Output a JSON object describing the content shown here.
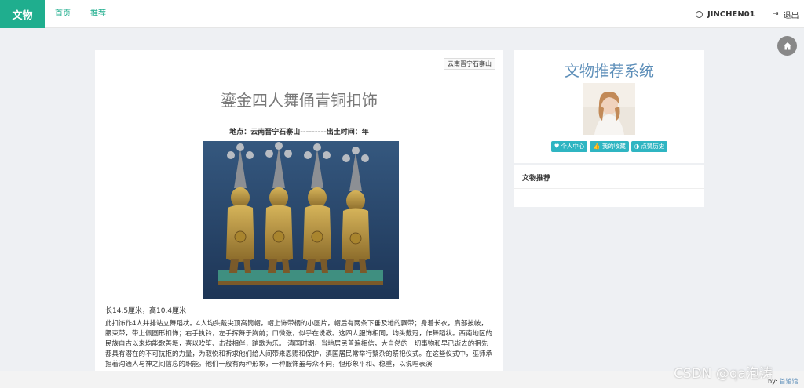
{
  "header": {
    "brand": "文物",
    "nav": {
      "home": "首页",
      "recommend": "推荐"
    },
    "username": "JINCHEN01",
    "logout": "退出"
  },
  "article": {
    "location_badge": "云南晋宁石寨山",
    "title": "鎏金四人舞俑青铜扣饰",
    "meta": "地点：云南晋宁石寨山---------出土时间：年",
    "dimensions": "长14.5厘米，高10.4厘米",
    "description": "此扣饰作4人并排站立舞蹈状。4人均头戴尖顶高筒帽，帽上饰带柄的小圆片，帽后有两条下垂及地的飘带；身着长衣，肩部披帔，腰束带，带上佩圆形扣饰；右手执铃，左手挥舞于胸前；口微张，似乎在说教。这四人服饰相同，均头戴冠，作舞蹈状。西南地区的民族自古以来均能歌善舞，喜以吹笙、击鼓相伴，踏歌为乐。 滇国时期，当地居民普遍相信，大自然的一切事物和早已逝去的祖先都具有潜在的不可抗拒的力量，为取悦和祈求他们给人间带来恩赐和保护，滇国居民常举行繁杂的祭祀仪式。在这些仪式中，巫师承担着沟通人与神之间信息的职能。他们一般有两种形象，一种服饰虽与众不同，但形象平和、稳重，以说唱表演"
  },
  "sidebar": {
    "title": "文物推荐系统",
    "buttons": {
      "profile": "个人中心",
      "favorites": "我的收藏",
      "history": "点赞历史"
    },
    "recommend_title": "文物推荐"
  },
  "footer": {
    "by": "by:",
    "author": "首馆馆"
  },
  "watermark": "CSDN @qa泡涛",
  "colors": {
    "brand": "#1fae8e",
    "accent_blue": "#5b8db8",
    "pill": "#2fb5c2"
  },
  "icons": {
    "user": "circle-user-icon",
    "logout": "sign-out-icon",
    "fab": "home-icon"
  }
}
